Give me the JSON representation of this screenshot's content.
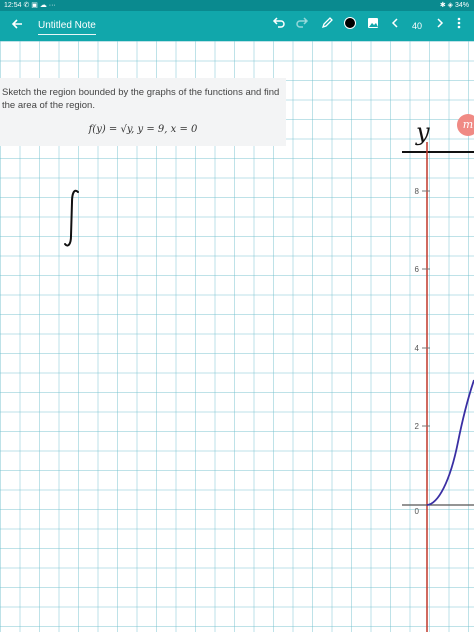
{
  "status_bar": {
    "time": "12:54",
    "left_icons": "✆ ▣ ☁ ···",
    "right_icons": "✱ ◈",
    "battery": "34%"
  },
  "app_bar": {
    "back_icon": "arrow-left-icon",
    "title": "Untitled Note",
    "undo_icon": "undo-icon",
    "redo_icon": "redo-icon",
    "pen_icon": "pen-icon",
    "color_icon": "black-color-swatch-icon",
    "image_icon": "image-icon",
    "prev_icon": "chevron-left-icon",
    "page_number": "40",
    "next_icon": "chevron-right-icon",
    "more_icon": "more-vert-icon"
  },
  "colors": {
    "status_bar": "#0a8a8f",
    "app_bar": "#11a7ab",
    "grid": "#9fd3dd",
    "axis_red": "#c0392b",
    "curve": "#3a2fa3"
  },
  "problem": {
    "text": "Sketch the region bounded by the graphs of the functions and find the area of the region.",
    "formula": "f(y) = √y, y = 9, x = 0"
  },
  "handwriting": {
    "y_label": "y",
    "integral_symbol": "∫"
  },
  "graph": {
    "tick_labels": [
      "8",
      "6",
      "4",
      "2",
      "0"
    ]
  },
  "badge": {
    "letter": "m"
  }
}
